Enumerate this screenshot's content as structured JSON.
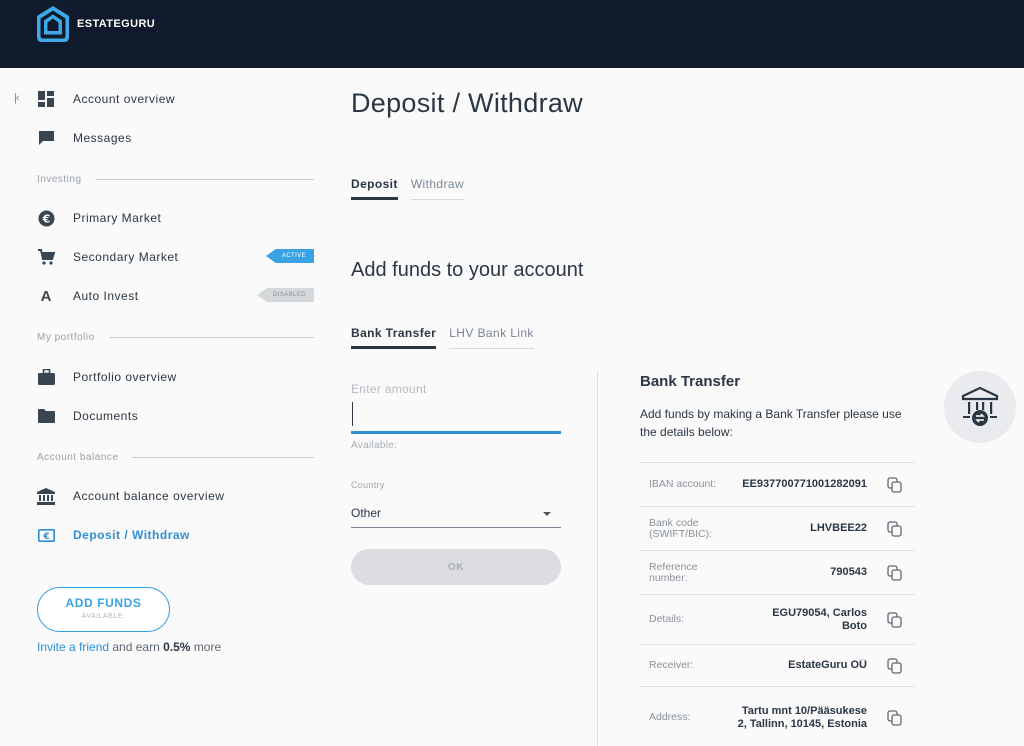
{
  "header": {
    "brand": "ESTATEGURU"
  },
  "sidebar": {
    "collapse": "|‹",
    "items": {
      "account_overview": "Account overview",
      "messages": "Messages",
      "primary_market": "Primary Market",
      "secondary_market": "Secondary Market",
      "auto_invest": "Auto Invest",
      "portfolio_overview": "Portfolio overview",
      "documents": "Documents",
      "account_balance_overview": "Account balance overview",
      "deposit_withdraw": "Deposit / Withdraw"
    },
    "sections": {
      "investing": "Investing",
      "my_portfolio": "My portfolio",
      "account_balance": "Account balance"
    },
    "badges": {
      "secondary": "ACTIVE",
      "auto": "DISABLED"
    },
    "add_funds": {
      "label": "ADD FUNDS",
      "sub": "AVAILABLE:"
    },
    "invite": {
      "link": "Invite a friend",
      "text1": " and earn ",
      "bold": "0.5%",
      "text2": " more"
    }
  },
  "main": {
    "title": "Deposit / Withdraw",
    "tabs": {
      "deposit": "Deposit",
      "withdraw": "Withdraw"
    },
    "subtitle": "Add funds to your account",
    "method_tabs": {
      "bank_transfer": "Bank Transfer",
      "lhv": "LHV Bank Link"
    },
    "form": {
      "amount_label": "Enter amount",
      "amount_value": "",
      "available": "Available:",
      "country_label": "Country",
      "country_value": "Other",
      "ok": "OK"
    },
    "bank_transfer": {
      "title": "Bank Transfer",
      "desc": "Add funds by making a Bank Transfer please use the details below:",
      "rows": [
        {
          "label": "IBAN account:",
          "value": "EE937700771001282091"
        },
        {
          "label": "Bank code (SWIFT/BIC):",
          "value": "LHVBEE22"
        },
        {
          "label": "Reference number:",
          "value": "790543"
        },
        {
          "label": "Details:",
          "value": "EGU79054, Carlos Boto"
        },
        {
          "label": "Receiver:",
          "value": "EstateGuru OÜ"
        },
        {
          "label": "Address:",
          "value": "Tartu mnt 10/Pääsukese 2, Tallinn, 10145, Estonia"
        }
      ]
    }
  },
  "colors": {
    "header_bg": "#0f1b2d",
    "accent": "#2f8fd8",
    "badge_active": "#3aa3e3"
  }
}
